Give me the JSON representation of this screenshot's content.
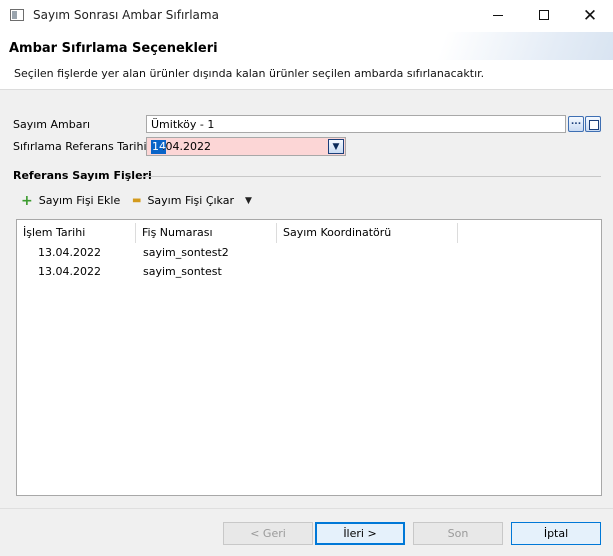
{
  "window": {
    "title": "Sayım Sonrası Ambar Sıfırlama",
    "minimize_icon": "minimize-icon",
    "maximize_icon": "maximize-icon",
    "close_icon": "close-icon",
    "close_glyph": "✕"
  },
  "banner": {
    "title": "Ambar Sıfırlama Seçenekleri",
    "description": "Seçilen fişlerde yer alan ürünler dışında kalan ürünler seçilen ambarda sıfırlanacaktır."
  },
  "form": {
    "warehouse_label": "Sayım Ambarı",
    "warehouse_value": "Ümitköy - 1",
    "warehouse_lookup_glyph": "...",
    "date_label": "Sıfırlama Referans Tarihi",
    "date_selected_part": "14",
    "date_rest": ".04.2022",
    "date_dropdown_glyph": "▼"
  },
  "group": {
    "title": "Referans Sayım Fişleri",
    "add_label": "Sayım Fişi Ekle",
    "add_glyph": "+",
    "remove_label": "Sayım Fişi Çıkar",
    "remove_glyph": "▬",
    "menu_glyph": "▼"
  },
  "table": {
    "headers": [
      "İşlem Tarihi",
      "Fiş Numarası",
      "Sayım Koordinatörü"
    ],
    "rows": [
      [
        "13.04.2022",
        "sayim_sontest2",
        ""
      ],
      [
        "13.04.2022",
        "sayim_sontest",
        ""
      ]
    ]
  },
  "buttons": {
    "back": "< Geri",
    "next": "İleri >",
    "finish": "Son",
    "cancel": "İptal"
  }
}
